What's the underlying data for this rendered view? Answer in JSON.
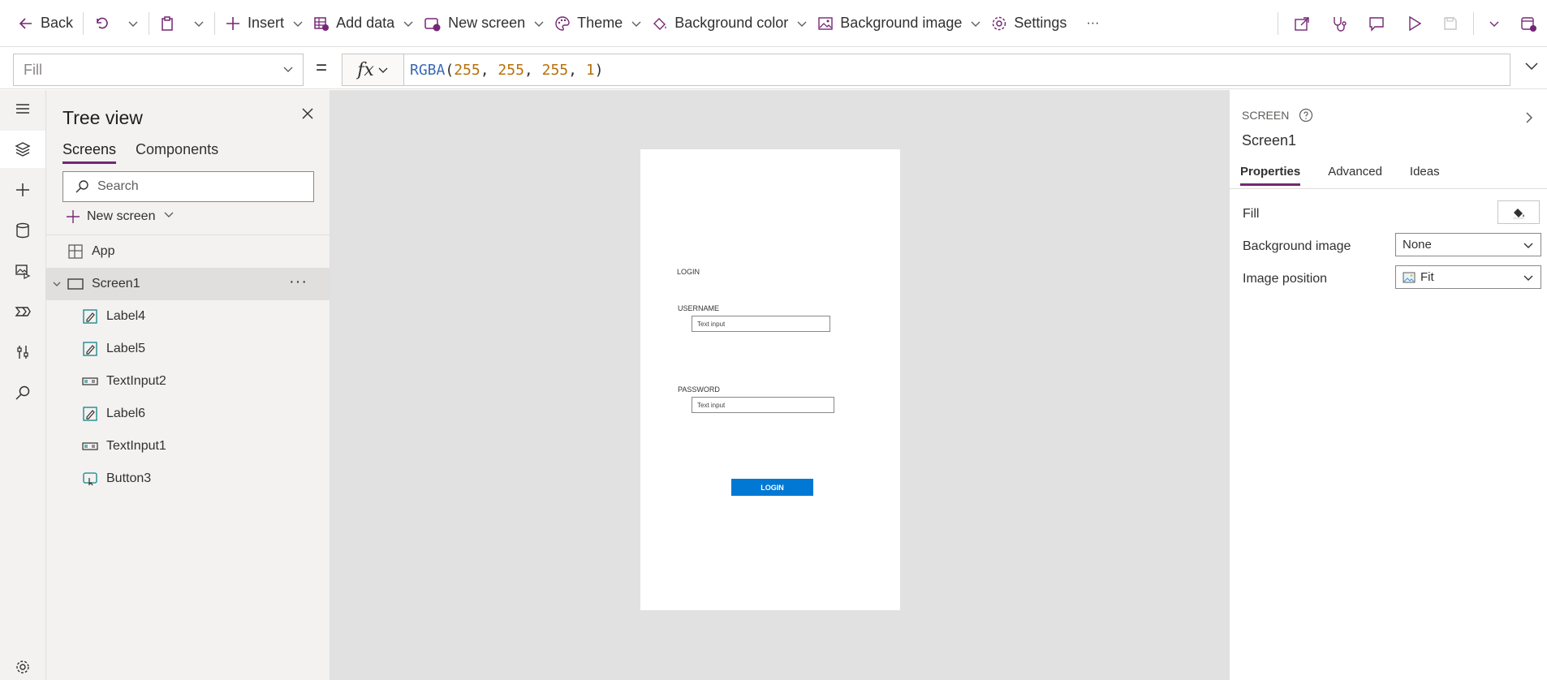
{
  "toolbar": {
    "back": "Back",
    "insert": "Insert",
    "add_data": "Add data",
    "new_screen": "New screen",
    "theme": "Theme",
    "background_color": "Background color",
    "background_image": "Background image",
    "settings": "Settings",
    "more": "···"
  },
  "formula_bar": {
    "property": "Fill",
    "equals": "=",
    "fx": "fx",
    "formula_fn": "RGBA",
    "formula_open": "(",
    "formula_args": [
      "255",
      "255",
      "255",
      "1"
    ],
    "formula_close": ")"
  },
  "tree_view": {
    "title": "Tree view",
    "tabs": [
      "Screens",
      "Components"
    ],
    "active_tab": "Screens",
    "search_placeholder": "Search",
    "new_screen": "New screen",
    "app": "App",
    "screen": "Screen1",
    "controls": [
      {
        "name": "Label4",
        "icon": "label-icon"
      },
      {
        "name": "Label5",
        "icon": "label-icon"
      },
      {
        "name": "TextInput2",
        "icon": "text-input-icon"
      },
      {
        "name": "Label6",
        "icon": "label-icon"
      },
      {
        "name": "TextInput1",
        "icon": "text-input-icon"
      },
      {
        "name": "Button3",
        "icon": "button-icon"
      }
    ]
  },
  "canvas": {
    "login_title": "LOGIN",
    "username_label": "USERNAME",
    "username_input": "Text input",
    "password_label": "PASSWORD",
    "password_input": "Text input",
    "login_button": "LOGIN",
    "button_color": "#0078d4"
  },
  "properties_panel": {
    "type": "SCREEN",
    "name": "Screen1",
    "tabs": [
      "Properties",
      "Advanced",
      "Ideas"
    ],
    "active_tab": "Properties",
    "fill_label": "Fill",
    "background_image_label": "Background image",
    "background_image_value": "None",
    "image_position_label": "Image position",
    "image_position_value": "Fit"
  },
  "colors": {
    "accent": "#742774",
    "canvas_bg": "#e1e1e1",
    "panel_bg": "#f3f2f1"
  }
}
